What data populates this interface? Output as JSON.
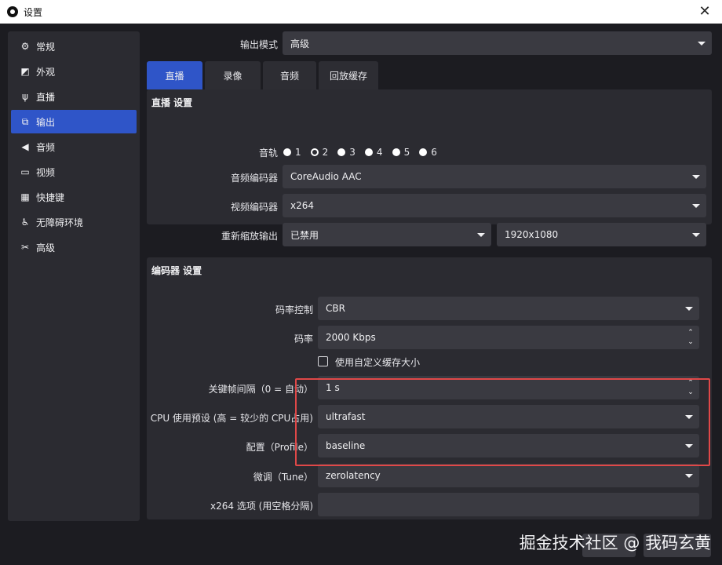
{
  "window": {
    "title": "设置",
    "close_glyph": "✕"
  },
  "sidebar": {
    "items": [
      {
        "label": "常规",
        "icon": "gear-icon",
        "glyph": "⚙",
        "active": false
      },
      {
        "label": "外观",
        "icon": "appearance-icon",
        "glyph": "◩",
        "active": false
      },
      {
        "label": "直播",
        "icon": "broadcast-antenna-icon",
        "glyph": "ψ",
        "active": false
      },
      {
        "label": "输出",
        "icon": "output-icon",
        "glyph": "⧉",
        "active": true
      },
      {
        "label": "音频",
        "icon": "speaker-icon",
        "glyph": "◀",
        "active": false
      },
      {
        "label": "视频",
        "icon": "monitor-icon",
        "glyph": "▭",
        "active": false
      },
      {
        "label": "快捷键",
        "icon": "keyboard-icon",
        "glyph": "▦",
        "active": false
      },
      {
        "label": "无障碍环境",
        "icon": "accessibility-icon",
        "glyph": "♿",
        "active": false
      },
      {
        "label": "高级",
        "icon": "tools-icon",
        "glyph": "✂",
        "active": false
      }
    ]
  },
  "output_mode": {
    "label": "输出模式",
    "value": "高级"
  },
  "tabs": [
    {
      "label": "直播",
      "active": true
    },
    {
      "label": "录像",
      "active": false
    },
    {
      "label": "音频",
      "active": false
    },
    {
      "label": "回放缓存",
      "active": false
    }
  ],
  "streaming": {
    "title": "直播 设置",
    "audio_track": {
      "label": "音轨",
      "tracks": [
        "1",
        "2",
        "3",
        "4",
        "5",
        "6"
      ],
      "selected": "2"
    },
    "audio_encoder": {
      "label": "音频编码器",
      "value": "CoreAudio AAC"
    },
    "video_encoder": {
      "label": "视频编码器",
      "value": "x264"
    },
    "rescale": {
      "label": "重新缩放输出",
      "value": "已禁用",
      "resolution": "1920x1080"
    }
  },
  "encoder": {
    "title": "编码器 设置",
    "rate_control": {
      "label": "码率控制",
      "value": "CBR"
    },
    "bitrate": {
      "label": "码率",
      "value": "2000 Kbps"
    },
    "custom_buffer": {
      "label": "使用自定义缓存大小",
      "checked": false
    },
    "keyframe": {
      "label": "关键帧间隔（0 = 自动）",
      "value": "1 s"
    },
    "cpu_preset": {
      "label": "CPU 使用预设 (高 = 较少的 CPU占用)",
      "value": "ultrafast"
    },
    "profile": {
      "label": "配置（Profile）",
      "value": "baseline"
    },
    "tune": {
      "label": "微调（Tune）",
      "value": "zerolatency"
    },
    "x264_opts": {
      "label": "x264 选项 (用空格分隔)",
      "value": ""
    }
  },
  "footer": {
    "watermark": "掘金技术社区 @ 我码玄黄"
  },
  "colors": {
    "accent": "#2f55c8",
    "highlight": "#e04848",
    "panel": "#2b2b31",
    "field": "#3a3a41"
  }
}
